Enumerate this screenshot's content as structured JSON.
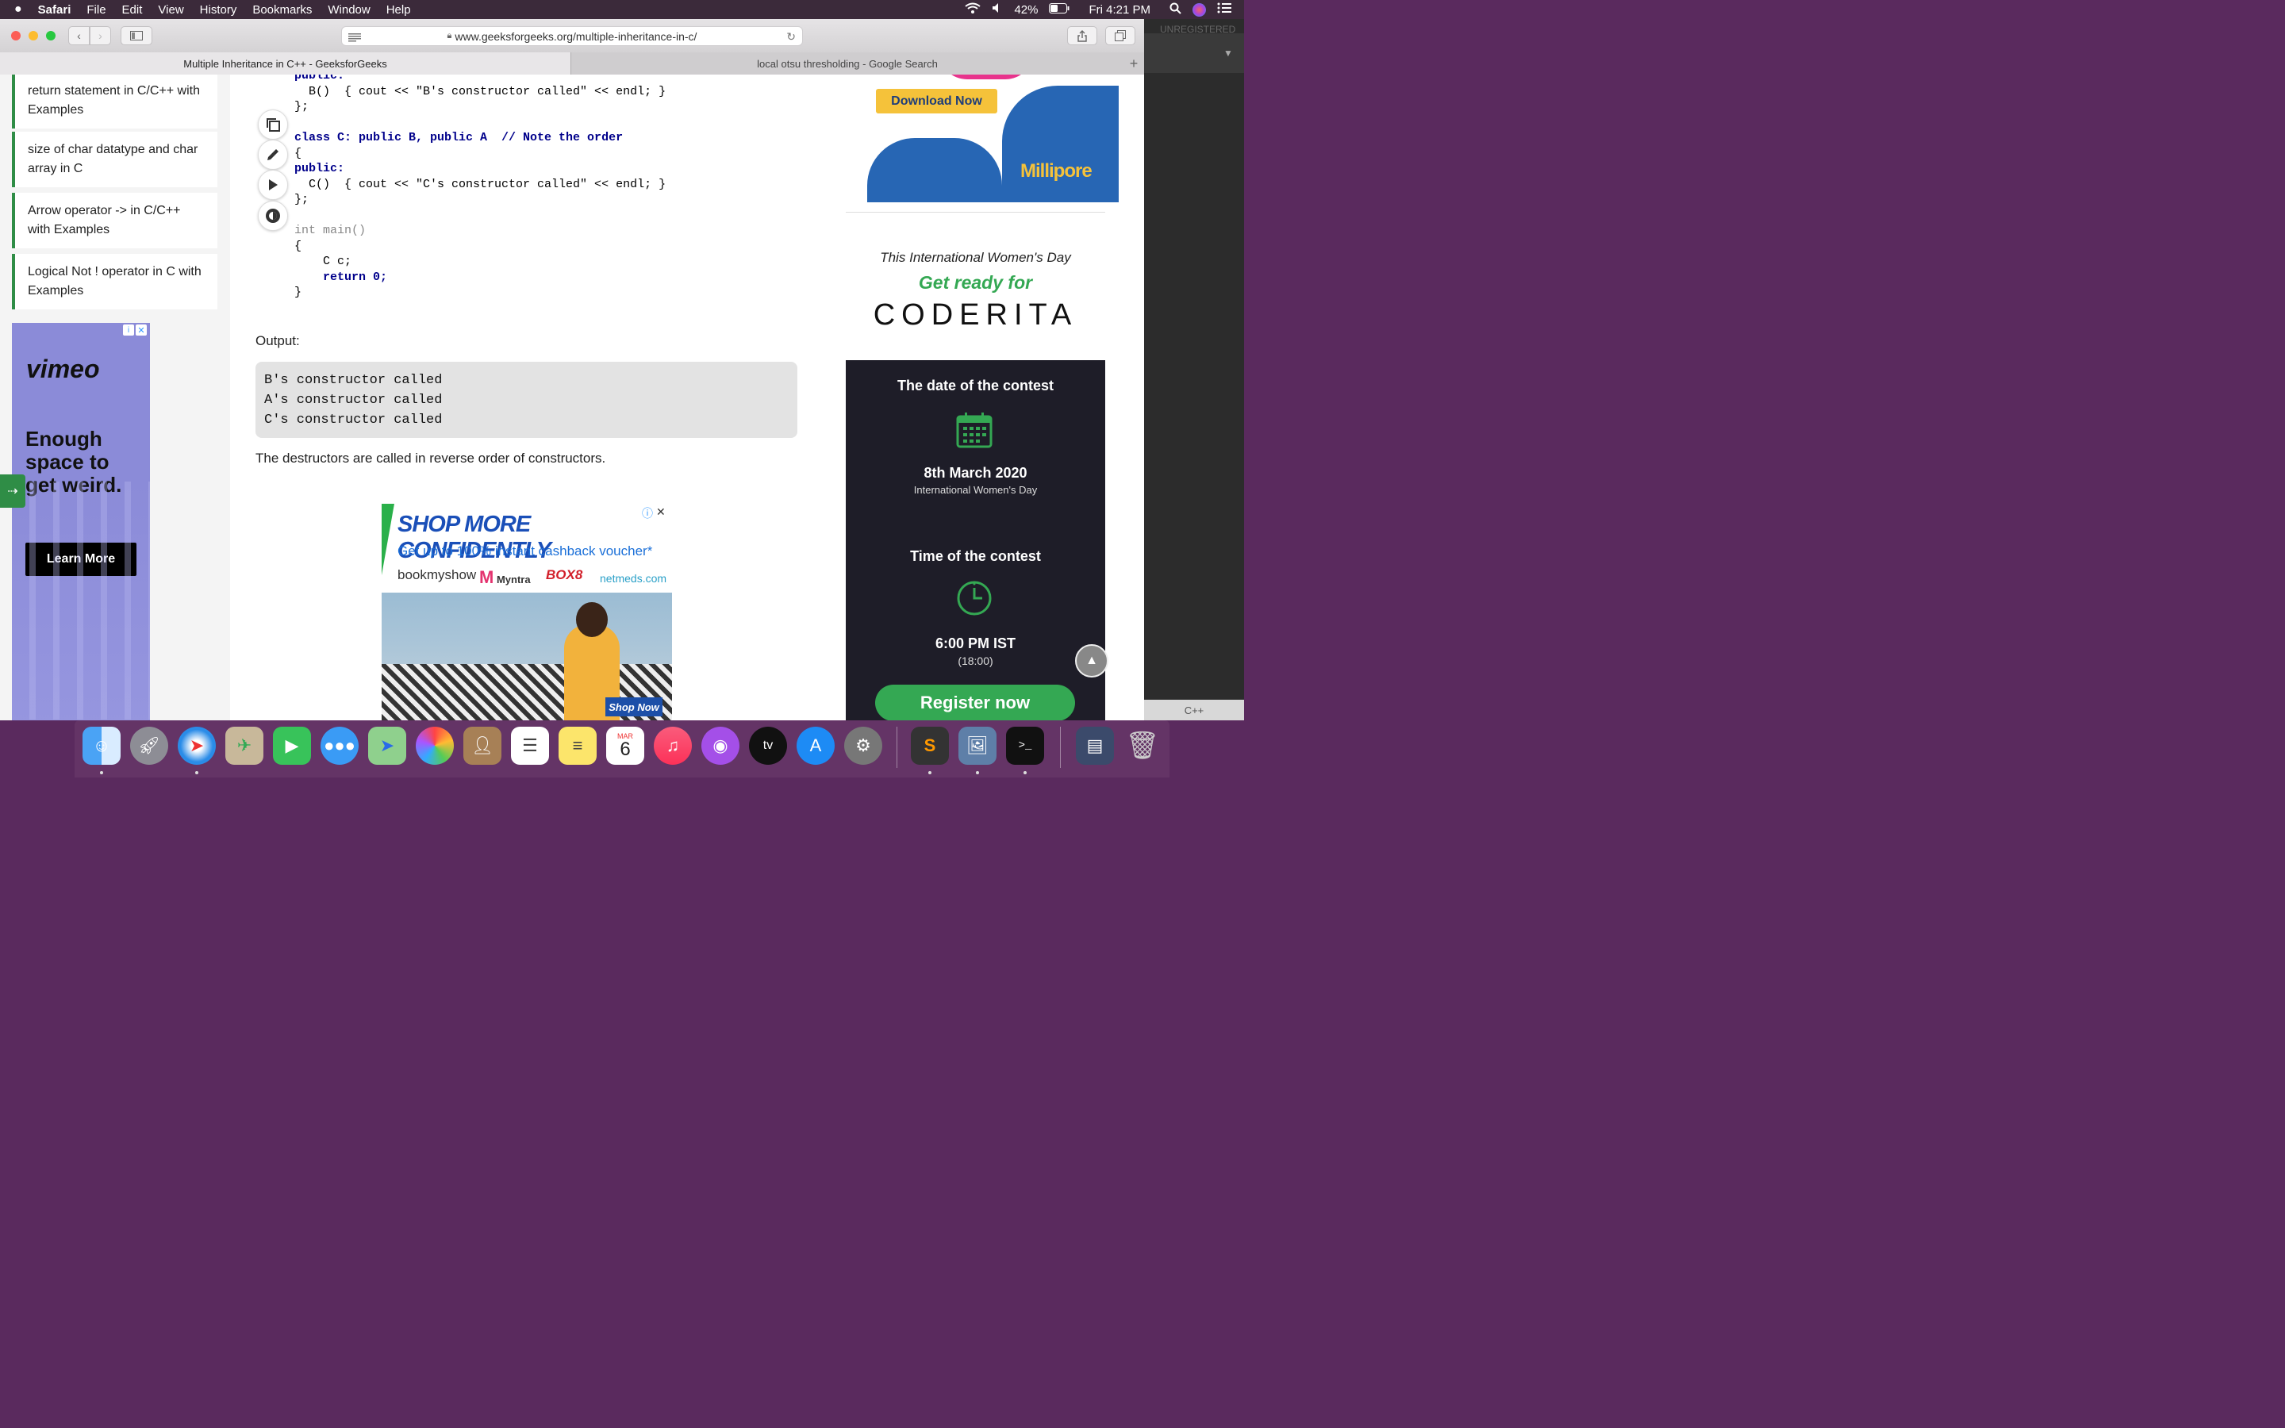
{
  "menubar": {
    "app": "Safari",
    "items": [
      "File",
      "Edit",
      "View",
      "History",
      "Bookmarks",
      "Window",
      "Help"
    ],
    "battery": "42%",
    "clock": "Fri 4:21 PM"
  },
  "toolbar": {
    "url": "www.geeksforgeeks.org/multiple-inheritance-in-c/"
  },
  "tabs": [
    {
      "label": "Multiple Inheritance in C++ - GeeksforGeeks",
      "active": true
    },
    {
      "label": "local otsu thresholding - Google Search",
      "active": false
    }
  ],
  "sidebar_links": [
    "return statement in C/C++ with Examples",
    "size of char datatype and char array in C",
    "Arrow operator -> in C/C++ with Examples",
    "Logical Not ! operator in C with Examples"
  ],
  "vimeo_ad": {
    "brand": "vimeo",
    "headline": "Enough space to get weird.",
    "cta": "Learn More"
  },
  "code_lines": [
    "public:",
    "  B()  { cout << \"B's constructor called\" << endl; }",
    "};",
    "",
    "class C: public B, public A  // Note the order",
    "{",
    "public:",
    "  C()  { cout << \"C's constructor called\" << endl; }",
    "};",
    "",
    "int main()",
    "{",
    "    C c;",
    "    return 0;",
    "}"
  ],
  "output": {
    "label": "Output:",
    "lines": [
      "B's constructor called",
      "A's constructor called",
      "C's constructor called"
    ],
    "note": "The destructors are called in reverse order of constructors."
  },
  "shop_ad": {
    "headline": "SHOP MORE CONFIDENTLY",
    "subline": "Get up to 100% instant cashback voucher*",
    "brands": [
      "bookmyshow",
      "Myntra",
      "BOX8",
      "netmeds.com"
    ],
    "cta": "Shop Now"
  },
  "millipore_ad": {
    "cta": "Download Now",
    "brand": "Millipore"
  },
  "coderita_ad": {
    "line1": "This International Women's Day",
    "line2": "Get ready for",
    "brand": "CODERITA",
    "date_title": "The date of the contest",
    "date": "8th March 2020",
    "date_sub": "International Women's Day",
    "time_title": "Time of the contest",
    "time": "6:00 PM IST",
    "time_sub": "(18:00)",
    "cta": "Register now"
  },
  "sublime": {
    "label": "UNREGISTERED",
    "syntax": "C++"
  },
  "dock": {
    "calendar_month": "MAR",
    "calendar_day": "6"
  }
}
